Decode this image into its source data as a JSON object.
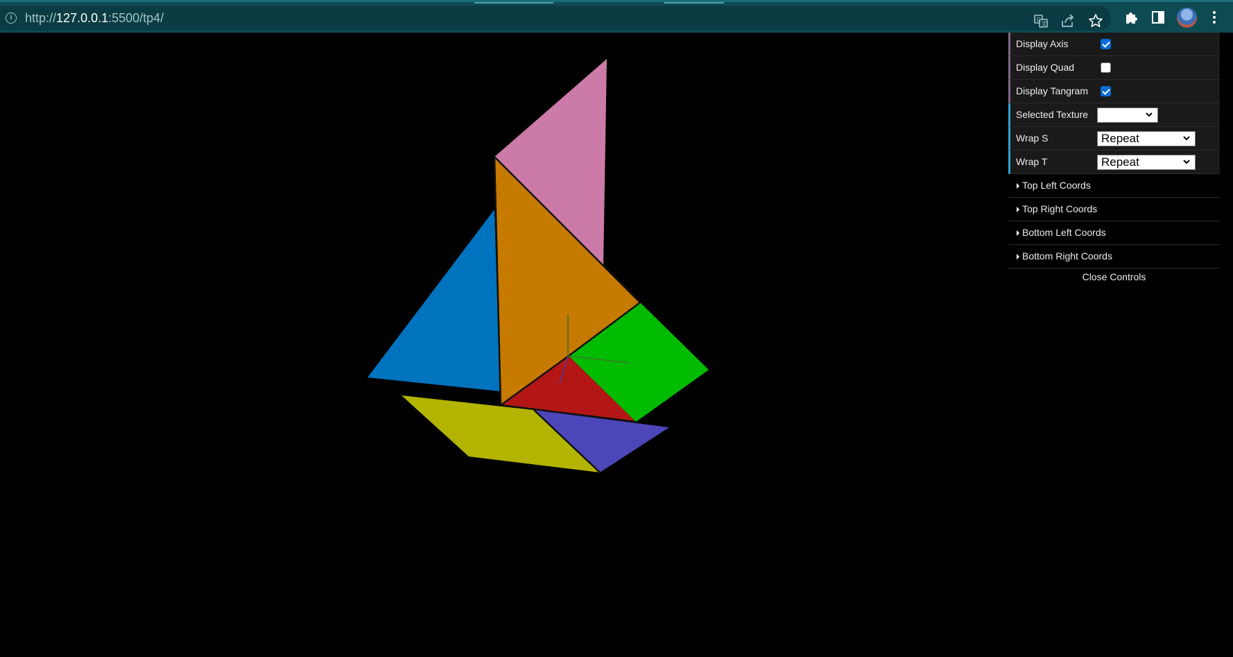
{
  "browser": {
    "url_scheme": "http://",
    "url_host": "127.0.0.1",
    "url_rest": ":5500/tp4/",
    "icons": [
      "site-info-icon",
      "translate-icon",
      "share-icon",
      "bookmark-star-icon",
      "extensions-icon",
      "side-panel-icon",
      "profile-avatar",
      "more-menu-icon"
    ]
  },
  "gui": {
    "controls": [
      {
        "label": "Display Axis",
        "type": "checkbox",
        "checked": true
      },
      {
        "label": "Display Quad",
        "type": "checkbox",
        "checked": false
      },
      {
        "label": "Display Tangram",
        "type": "checkbox",
        "checked": true
      },
      {
        "label": "Selected Texture",
        "type": "select",
        "value": ""
      },
      {
        "label": "Wrap S",
        "type": "select",
        "value": "Repeat"
      },
      {
        "label": "Wrap T",
        "type": "select",
        "value": "Repeat"
      }
    ],
    "folders": [
      "Top Left Coords",
      "Top Right Coords",
      "Bottom Left Coords",
      "Bottom Right Coords"
    ],
    "close_label": "Close Controls"
  },
  "scene": {
    "background": "#000000",
    "pieces": [
      {
        "name": "pink",
        "color": "#cc7aa8"
      },
      {
        "name": "orange",
        "color": "#c77a00"
      },
      {
        "name": "blue",
        "color": "#0073bf"
      },
      {
        "name": "green",
        "color": "#00bb00"
      },
      {
        "name": "red",
        "color": "#b41616"
      },
      {
        "name": "yellow",
        "color": "#b3b400"
      },
      {
        "name": "purple",
        "color": "#4c46b8"
      }
    ]
  }
}
